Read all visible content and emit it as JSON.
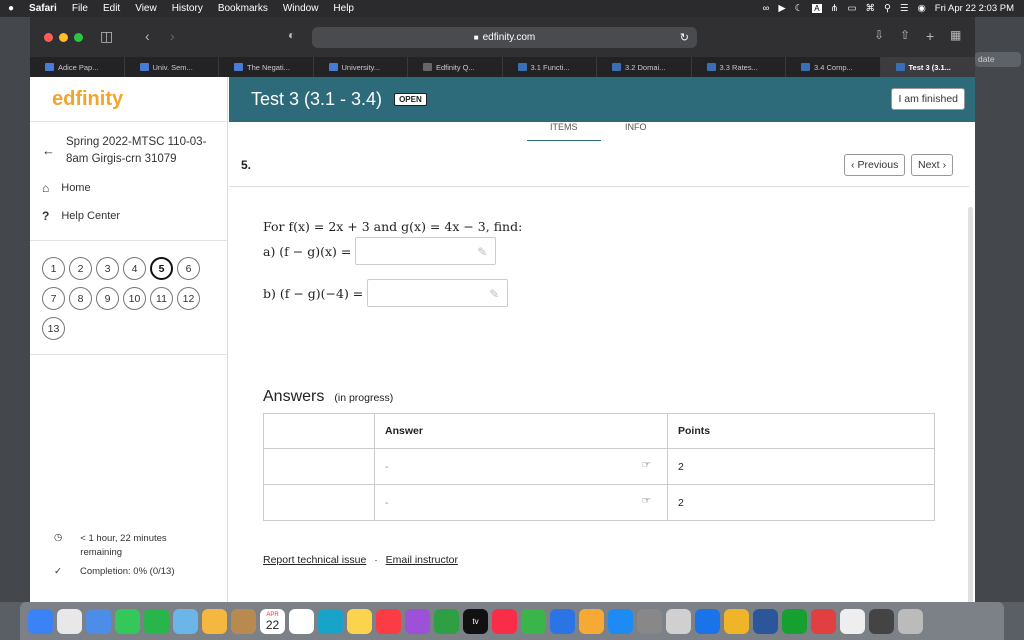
{
  "menubar": {
    "app": "Safari",
    "items": [
      "File",
      "Edit",
      "View",
      "History",
      "Bookmarks",
      "Window",
      "Help"
    ],
    "datetime": "Fri Apr 22  2:03 PM"
  },
  "browser": {
    "url": "edfinity.com",
    "side_pill": "date"
  },
  "tabs": [
    {
      "label": "Adice Pap...",
      "color": "#4a7ad8"
    },
    {
      "label": "Univ. Sem...",
      "color": "#4a7ad8"
    },
    {
      "label": "The Negati...",
      "color": "#4a7ad8"
    },
    {
      "label": "University...",
      "color": "#4a7ad8"
    },
    {
      "label": "Edfinity Q...",
      "color": "#666666"
    },
    {
      "label": "3.1 Functi...",
      "color": "#3a6fb5"
    },
    {
      "label": "3.2 Domai...",
      "color": "#3a6fb5"
    },
    {
      "label": "3.3 Rates...",
      "color": "#3a6fb5"
    },
    {
      "label": "3.4 Comp...",
      "color": "#3a6fb5"
    },
    {
      "label": "Test 3 (3.1...",
      "color": "#3a6fb5"
    }
  ],
  "sidebar": {
    "logo": "edfinity",
    "course": "Spring 2022-MTSC 110-03-8am Girgis-crn 31079",
    "home": "Home",
    "help": "Help Center",
    "questions": [
      "1",
      "2",
      "3",
      "4",
      "5",
      "6",
      "7",
      "8",
      "9",
      "10",
      "11",
      "12",
      "13"
    ],
    "active_question": "5",
    "time_remaining": "< 1 hour, 22 minutes remaining",
    "completion": "Completion: 0% (0/13)"
  },
  "header": {
    "title": "Test 3 (3.1 - 3.4)",
    "badge": "OPEN",
    "finish_button": "I am finished"
  },
  "content_tabs": {
    "items": "ITEMS",
    "info": "INFO"
  },
  "question": {
    "number": "5.",
    "prev": "Previous",
    "next": "Next",
    "prompt": "For f(x) = 2x + 3 and g(x) = 4x − 3, find:",
    "part_a": "a) (f − g)(x) =",
    "part_b": "b) (f − g)(−4) ="
  },
  "answers": {
    "title": "Answers",
    "status": "(in progress)",
    "columns": [
      "",
      "Answer",
      "Points"
    ],
    "rows": [
      {
        "label": "",
        "answer": "-",
        "points": "2"
      },
      {
        "label": "",
        "answer": "-",
        "points": "2"
      }
    ]
  },
  "footer": {
    "report": "Report technical issue",
    "sep": "·",
    "email": "Email instructor"
  },
  "dock": {
    "calendar_month": "APR",
    "calendar_day": "22",
    "tv": "tv"
  }
}
